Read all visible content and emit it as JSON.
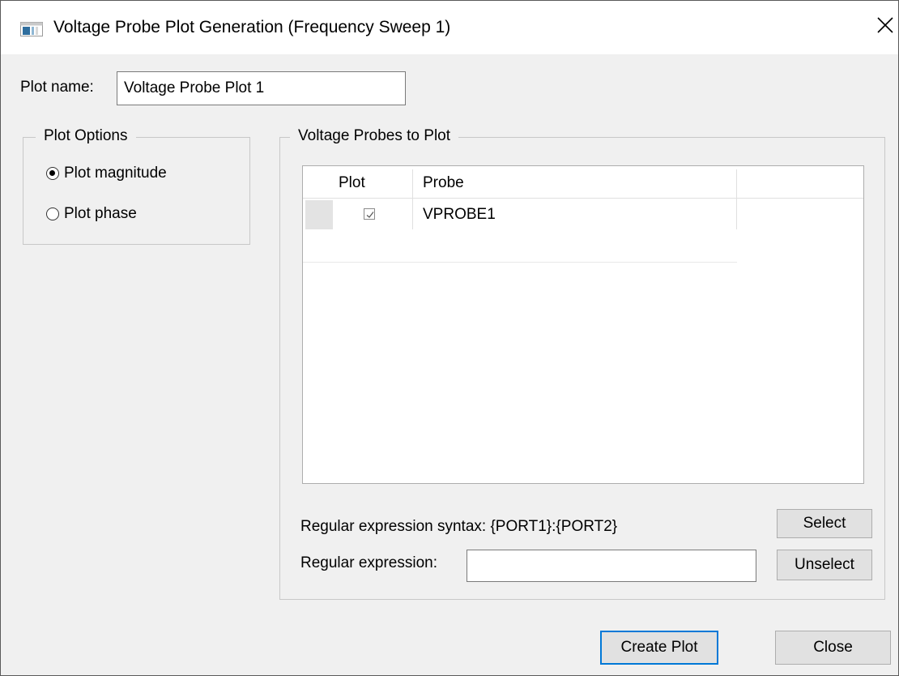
{
  "window": {
    "title": "Voltage Probe Plot Generation (Frequency Sweep 1)",
    "app_icon": "window-app-icon",
    "close_icon": "close-icon"
  },
  "plot_name": {
    "label": "Plot name:",
    "value": "Voltage Probe Plot 1"
  },
  "plot_options": {
    "title": "Plot Options",
    "options": [
      {
        "label": "Plot magnitude",
        "checked": true
      },
      {
        "label": "Plot phase",
        "checked": false
      }
    ]
  },
  "probes": {
    "title": "Voltage Probes to Plot",
    "columns": [
      "Plot",
      "Probe"
    ],
    "rows": [
      {
        "plot": true,
        "probe": "VPROBE1"
      }
    ],
    "regex_syntax_label": "Regular expression syntax: {PORT1}:{PORT2}",
    "regex_label": "Regular expression:",
    "regex_value": "",
    "select_label": "Select",
    "unselect_label": "Unselect"
  },
  "footer": {
    "create_label": "Create Plot",
    "close_label": "Close"
  },
  "colors": {
    "focus_border": "#0078d7",
    "dialog_bg": "#f0f0f0"
  }
}
